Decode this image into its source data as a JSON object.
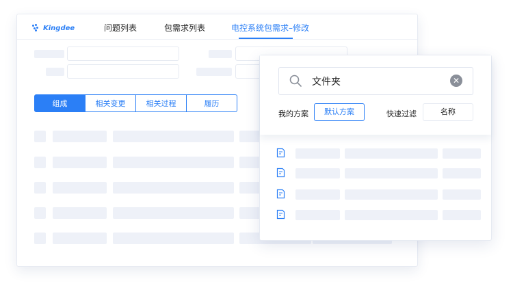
{
  "nav": {
    "logo_text": "Kingdee",
    "tabs": [
      {
        "label": "问题列表",
        "active": false
      },
      {
        "label": "包需求列表",
        "active": false
      },
      {
        "label": "电控系统包需求–修改",
        "active": true
      }
    ]
  },
  "segments": [
    {
      "label": "组成",
      "active": true
    },
    {
      "label": "相关变更",
      "active": false
    },
    {
      "label": "相关过程",
      "active": false
    },
    {
      "label": "履历",
      "active": false
    }
  ],
  "panel": {
    "search_value": "文件夹",
    "my_scheme_label": "我的方案",
    "default_scheme_button": "默认方案",
    "quick_filter_label": "快速过滤",
    "name_button": "名称"
  },
  "colors": {
    "accent": "#2b7ff6",
    "skeleton": "#eef1f8",
    "border": "#e6eaf2"
  },
  "icons": {
    "search": "search-icon",
    "clear": "clear-icon",
    "file": "document-icon"
  }
}
